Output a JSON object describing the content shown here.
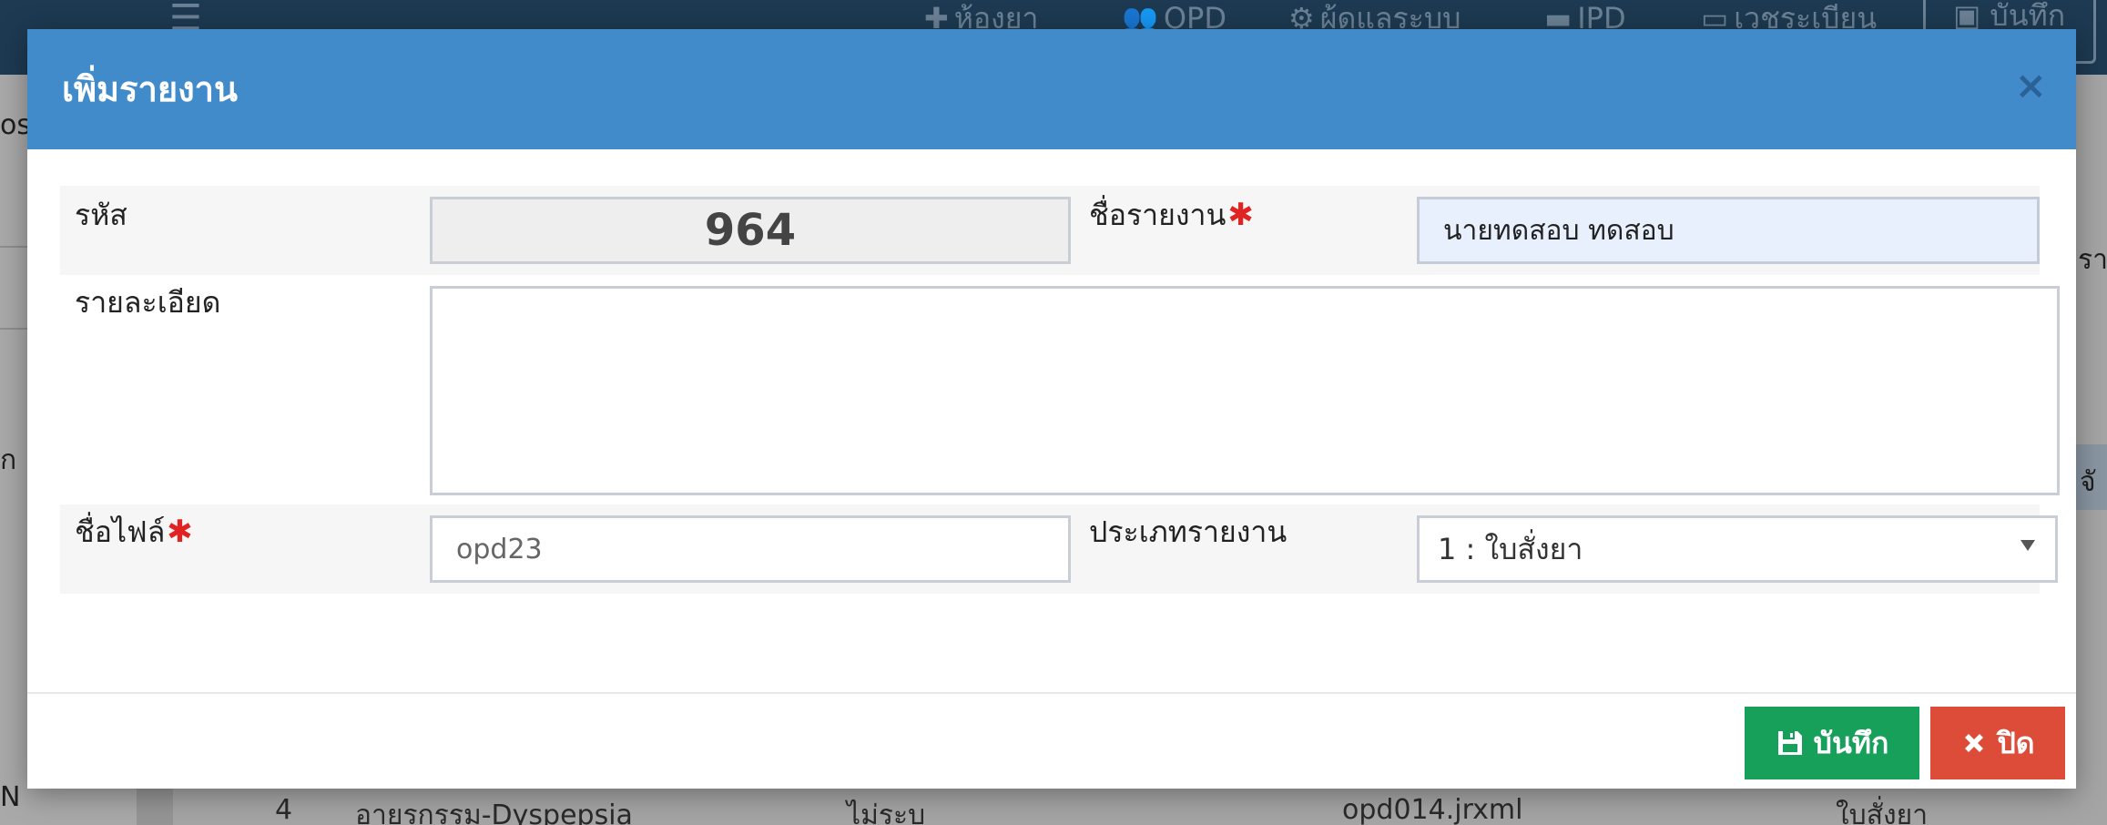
{
  "background": {
    "nav": [
      {
        "icon": "medicine-box-icon",
        "label": "ห้องยา"
      },
      {
        "icon": "users-icon",
        "label": "OPD"
      },
      {
        "icon": "gears-icon",
        "label": "ผู้ดูแลระบบ"
      },
      {
        "icon": "bed-icon",
        "label": "IPD"
      },
      {
        "icon": "card-icon",
        "label": "เวชระเบียน"
      }
    ],
    "save_label": "บันทึก",
    "fragments": {
      "left_top": "os",
      "left_mid": "ก",
      "left_bottom": "N",
      "right_top": "รา",
      "right_mid": "จั"
    },
    "table_row": {
      "no": "4",
      "name": "อายุรกรรม-Dyspepsia",
      "status": "ไม่ระบุ",
      "file": "opd014.jrxml",
      "type": "ใบสั่งยา"
    }
  },
  "modal": {
    "title": "เพิ่มรายงาน",
    "close_symbol": "×",
    "fields": {
      "code_label": "รหัส",
      "code_value": "964",
      "name_label": "ชื่อรายงาน",
      "name_value": "นายทดสอบ ทดสอบ",
      "detail_label": "รายละเอียด",
      "detail_value": "",
      "file_label": "ชื่อไฟล์",
      "file_value": "opd23",
      "type_label": "ประเภทรายงาน",
      "type_value": "1 : ใบสั่งยา"
    },
    "required_mark": "✱",
    "buttons": {
      "save": "บันทึก",
      "close": "ปิด"
    },
    "colors": {
      "header": "#428bcb",
      "save_button": "#16a05a",
      "close_button": "#dd4b39",
      "required": "#e02424"
    }
  }
}
